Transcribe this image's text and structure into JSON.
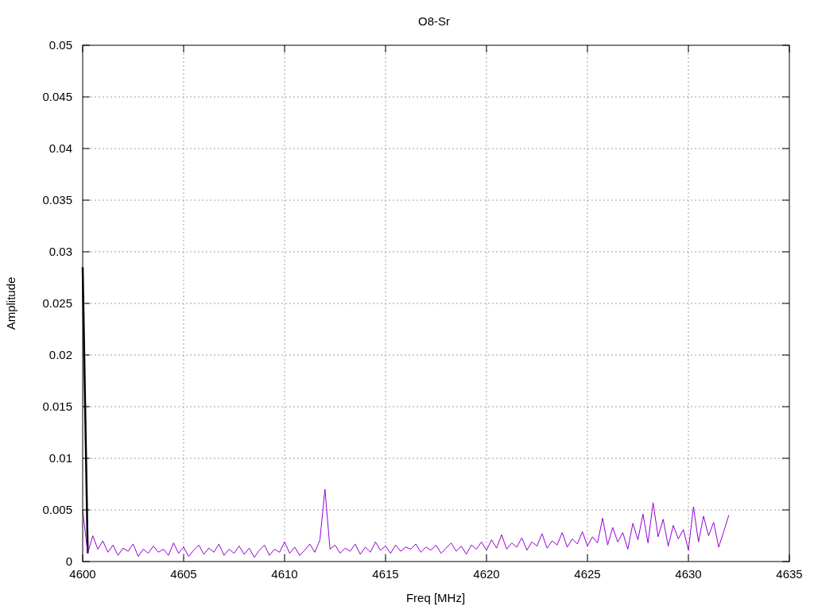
{
  "chart_data": {
    "type": "line",
    "title": "O8-Sr",
    "xlabel": "Freq [MHz]",
    "ylabel": "Amplitude",
    "grid": true,
    "xlim": [
      4600,
      4635
    ],
    "ylim": [
      0,
      0.05
    ],
    "xticks": [
      4600,
      4605,
      4610,
      4615,
      4620,
      4625,
      4630,
      4635
    ],
    "yticks": [
      {
        "value": 0,
        "label": "0"
      },
      {
        "value": 0.005,
        "label": "0.005"
      },
      {
        "value": 0.01,
        "label": "0.01"
      },
      {
        "value": 0.015,
        "label": "0.015"
      },
      {
        "value": 0.02,
        "label": "0.02"
      },
      {
        "value": 0.025,
        "label": "0.025"
      },
      {
        "value": 0.03,
        "label": "0.03"
      },
      {
        "value": 0.035,
        "label": "0.035"
      },
      {
        "value": 0.04,
        "label": "0.04"
      },
      {
        "value": 0.045,
        "label": "0.045"
      },
      {
        "value": 0.05,
        "label": "0.05"
      }
    ],
    "x": [
      4600,
      4600.25,
      4600.5,
      4600.75,
      4601,
      4601.25,
      4601.5,
      4601.75,
      4602,
      4602.25,
      4602.5,
      4602.75,
      4603,
      4603.25,
      4603.5,
      4603.75,
      4604,
      4604.25,
      4604.5,
      4604.75,
      4605,
      4605.25,
      4605.5,
      4605.75,
      4606,
      4606.25,
      4606.5,
      4606.75,
      4607,
      4607.25,
      4607.5,
      4607.75,
      4608,
      4608.25,
      4608.5,
      4608.75,
      4609,
      4609.25,
      4609.5,
      4609.75,
      4610,
      4610.25,
      4610.5,
      4610.75,
      4611,
      4611.25,
      4611.5,
      4611.75,
      4612,
      4612.25,
      4612.5,
      4612.75,
      4613,
      4613.25,
      4613.5,
      4613.75,
      4614,
      4614.25,
      4614.5,
      4614.75,
      4615,
      4615.25,
      4615.5,
      4615.75,
      4616,
      4616.25,
      4616.5,
      4616.75,
      4617,
      4617.25,
      4617.5,
      4617.75,
      4618,
      4618.25,
      4618.5,
      4618.75,
      4619,
      4619.25,
      4619.5,
      4619.75,
      4620,
      4620.25,
      4620.5,
      4620.75,
      4621,
      4621.25,
      4621.5,
      4621.75,
      4622,
      4622.25,
      4622.5,
      4622.75,
      4623,
      4623.25,
      4623.5,
      4623.75,
      4624,
      4624.25,
      4624.5,
      4624.75,
      4625,
      4625.25,
      4625.5,
      4625.75,
      4626,
      4626.25,
      4626.5,
      4626.75,
      4627,
      4627.25,
      4627.5,
      4627.75,
      4628,
      4628.25,
      4628.5,
      4628.75,
      4629,
      4629.25,
      4629.5,
      4629.75,
      4630,
      4630.25,
      4630.5,
      4630.75,
      4631,
      4631.25,
      4631.5,
      4631.75,
      4632
    ],
    "series": [
      {
        "color": "#000000",
        "values": [
          0.0285,
          0.0008,
          null,
          null,
          null,
          null,
          null,
          null,
          null,
          null,
          null,
          null,
          null,
          null,
          null,
          null,
          null,
          null,
          null,
          null,
          null,
          null,
          null,
          null,
          null,
          null,
          null,
          null,
          null,
          null,
          null,
          null,
          null,
          null,
          null,
          null,
          null,
          null,
          null,
          null,
          null,
          null,
          null,
          null,
          null,
          null,
          null,
          null,
          null,
          null,
          null,
          null,
          null,
          null,
          null,
          null,
          null,
          null,
          null,
          null,
          null,
          null,
          null,
          null,
          null,
          null,
          null,
          null,
          null,
          null,
          null,
          null,
          null,
          null,
          null,
          null,
          null,
          null,
          null,
          null,
          null,
          null,
          null,
          null,
          null,
          null,
          null,
          null,
          null,
          null,
          null,
          null,
          null,
          null,
          null,
          null,
          null,
          null,
          null,
          null,
          null,
          null,
          null,
          null,
          null,
          null,
          null,
          null,
          null,
          null,
          null,
          null,
          null,
          null,
          null,
          null,
          null,
          null,
          null,
          null,
          null,
          null,
          null,
          null,
          null,
          null,
          null,
          null,
          null
        ]
      },
      {
        "color": "#9400d3",
        "values": [
          0.005,
          0.0008,
          0.0025,
          0.0012,
          0.002,
          0.0009,
          0.0016,
          0.0006,
          0.0013,
          0.001,
          0.0017,
          0.0005,
          0.0012,
          0.0008,
          0.0015,
          0.0009,
          0.0012,
          0.0006,
          0.0018,
          0.0008,
          0.0014,
          0.0005,
          0.0011,
          0.0016,
          0.0007,
          0.0013,
          0.0009,
          0.0017,
          0.0006,
          0.0012,
          0.0008,
          0.0015,
          0.0007,
          0.0013,
          0.0004,
          0.0011,
          0.0016,
          0.0006,
          0.0012,
          0.0009,
          0.0019,
          0.0008,
          0.0014,
          0.0006,
          0.0011,
          0.0017,
          0.0009,
          0.0021,
          0.007,
          0.0012,
          0.0016,
          0.0008,
          0.0013,
          0.001,
          0.0017,
          0.0007,
          0.0014,
          0.0009,
          0.0019,
          0.0011,
          0.0015,
          0.0008,
          0.0016,
          0.001,
          0.0014,
          0.0012,
          0.0017,
          0.0009,
          0.0014,
          0.0011,
          0.0016,
          0.0008,
          0.0013,
          0.0018,
          0.001,
          0.0015,
          0.0007,
          0.0016,
          0.0012,
          0.0019,
          0.0011,
          0.0021,
          0.0013,
          0.0026,
          0.0012,
          0.0018,
          0.0014,
          0.0023,
          0.0011,
          0.0019,
          0.0015,
          0.0027,
          0.0013,
          0.002,
          0.0016,
          0.0028,
          0.0014,
          0.0022,
          0.0017,
          0.0029,
          0.0015,
          0.0024,
          0.0018,
          0.0042,
          0.0016,
          0.0033,
          0.0019,
          0.0028,
          0.0012,
          0.0037,
          0.0021,
          0.0046,
          0.0018,
          0.0057,
          0.0024,
          0.0041,
          0.0015,
          0.0035,
          0.0022,
          0.0031,
          0.0011,
          0.0053,
          0.0019,
          0.0044,
          0.0025,
          0.0038,
          0.0014,
          0.0029,
          0.0045
        ]
      }
    ]
  }
}
